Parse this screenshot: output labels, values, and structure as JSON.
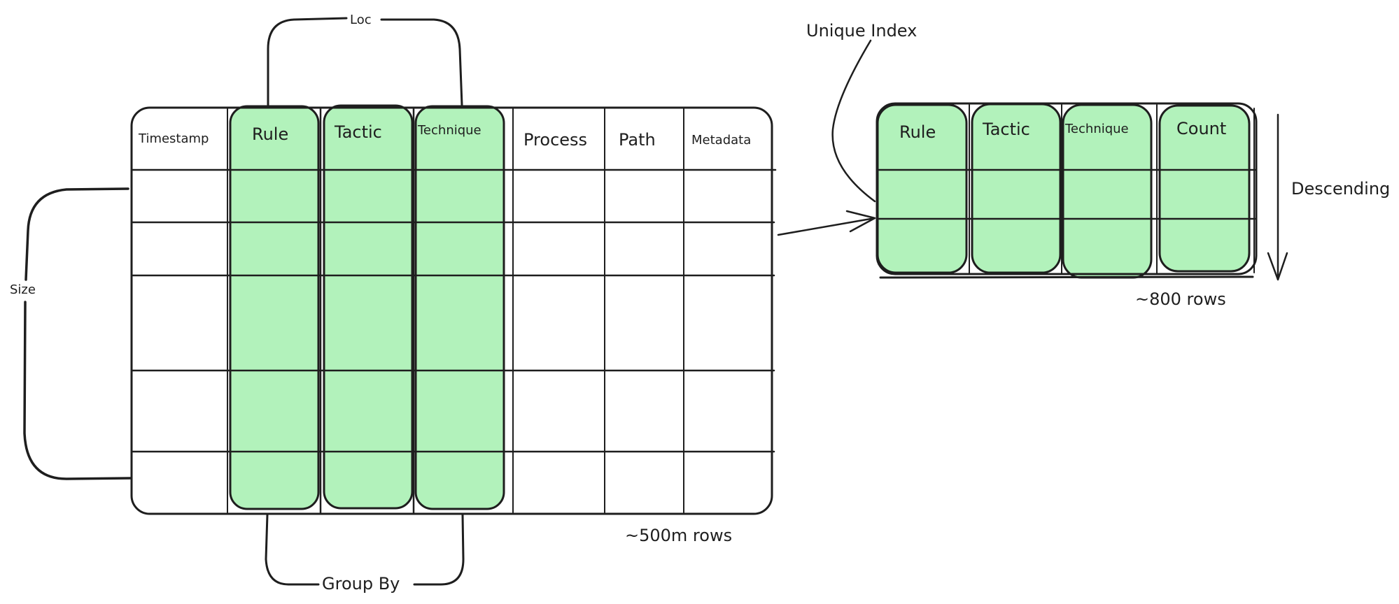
{
  "source_table": {
    "columns": [
      {
        "label": "Timestamp",
        "highlighted": false
      },
      {
        "label": "Rule",
        "highlighted": true
      },
      {
        "label": "Tactic",
        "highlighted": true
      },
      {
        "label": "Technique",
        "highlighted": true
      },
      {
        "label": "Process",
        "highlighted": false
      },
      {
        "label": "Path",
        "highlighted": false
      },
      {
        "label": "Metadata",
        "highlighted": false
      }
    ],
    "row_count_label": "~500m rows"
  },
  "result_table": {
    "columns": [
      {
        "label": "Rule"
      },
      {
        "label": "Tactic"
      },
      {
        "label": "Technique"
      },
      {
        "label": "Count"
      }
    ],
    "row_count_label": "~800 rows"
  },
  "annotations": {
    "loc": "Loc",
    "group_by": "Group By",
    "size": "Size",
    "unique_index": "Unique Index",
    "descending": "Descending"
  },
  "colors": {
    "highlight_fill": "#b2f2bb",
    "stroke": "#1e1e1e"
  }
}
